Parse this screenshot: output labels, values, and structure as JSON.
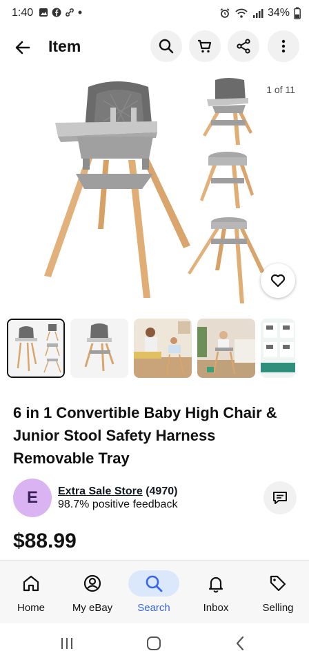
{
  "status_bar": {
    "time": "1:40",
    "battery": "34%"
  },
  "header": {
    "title": "Item"
  },
  "gallery": {
    "counter": "1 of 11"
  },
  "product": {
    "title": "6 in 1 Convertible Baby High Chair & Junior Stool Safety Harness Removable Tray",
    "price": "$88.99"
  },
  "seller": {
    "avatar_letter": "E",
    "name": "Extra Sale Store",
    "feedback_count": "(4970)",
    "positive_feedback": "98.7% positive feedback"
  },
  "bottom_nav": {
    "home": "Home",
    "my_ebay": "My eBay",
    "search": "Search",
    "inbox": "Inbox",
    "selling": "Selling"
  },
  "colors": {
    "accent": "#3665f3",
    "avatar_bg": "#d9b3f2"
  }
}
